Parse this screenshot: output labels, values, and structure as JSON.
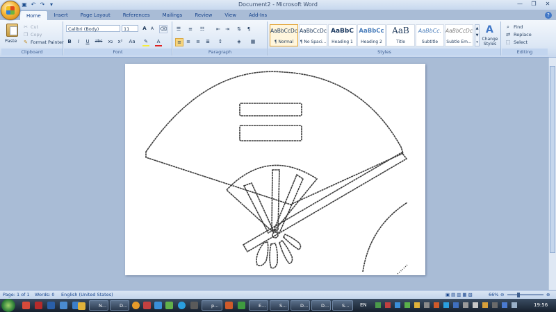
{
  "window": {
    "title": "Document2 - Microsoft Word",
    "controls": [
      "minimize-icon",
      "maximize-icon",
      "close-icon"
    ]
  },
  "quick_access": [
    "save-icon",
    "undo-icon",
    "redo-icon",
    "customize-icon"
  ],
  "tabs": [
    {
      "label": "Home",
      "active": true
    },
    {
      "label": "Insert"
    },
    {
      "label": "Page Layout"
    },
    {
      "label": "References"
    },
    {
      "label": "Mailings"
    },
    {
      "label": "Review"
    },
    {
      "label": "View"
    },
    {
      "label": "Add-Ins"
    }
  ],
  "ribbon": {
    "clipboard": {
      "paste": "Paste",
      "cut": "Cut",
      "copy": "Copy",
      "format_painter": "Format Painter",
      "label": "Clipboard"
    },
    "font": {
      "name": "Calibri (Body)",
      "size": "11",
      "bold": "B",
      "italic": "I",
      "underline": "U",
      "strike": "abc",
      "subscript": "x₂",
      "superscript": "x²",
      "change_case": "Aa",
      "grow": "A",
      "shrink": "A",
      "label": "Font"
    },
    "paragraph": {
      "label": "Paragraph"
    },
    "styles": {
      "label": "Styles",
      "items": [
        {
          "sample": "AaBbCcDc",
          "name": "¶ Normal",
          "active": true
        },
        {
          "sample": "AaBbCcDc",
          "name": "¶ No Spaci..."
        },
        {
          "sample": "AaBbC",
          "name": "Heading 1"
        },
        {
          "sample": "AaBbCc",
          "name": "Heading 2"
        },
        {
          "sample": "AaB",
          "name": "Title"
        },
        {
          "sample": "AaBbCc.",
          "name": "Subtitle"
        },
        {
          "sample": "AaBbCcDc",
          "name": "Subtle Em..."
        }
      ],
      "change_styles": "Change Styles"
    },
    "editing": {
      "find": "Find",
      "replace": "Replace",
      "select": "Select",
      "label": "Editing"
    }
  },
  "status": {
    "page": "Page: 1 of 1",
    "words": "Words: 0",
    "language": "English (United States)",
    "zoom": "66%"
  },
  "taskbar": {
    "buttons": [
      "N...",
      "D...",
      "D...",
      "p...",
      "E...",
      "S...",
      "D...",
      "S..."
    ],
    "language": "EN",
    "clock": "19:56"
  }
}
